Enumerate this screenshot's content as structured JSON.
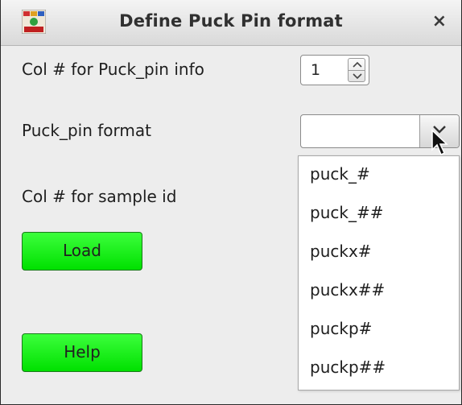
{
  "window": {
    "title": "Define Puck Pin format",
    "close_glyph": "×",
    "icon": "app-logo-icon"
  },
  "form": {
    "col_puck_pin_label": "Col # for Puck_pin info",
    "col_puck_pin_value": "1",
    "puck_pin_format_label": "Puck_pin format",
    "puck_pin_format_value": "",
    "col_sample_id_label": "Col # for sample id"
  },
  "dropdown": {
    "options": [
      "puck_#",
      "puck_##",
      "puckx#",
      "puckx##",
      "puckp#",
      "puckp##"
    ]
  },
  "buttons": {
    "load_label": "Load",
    "help_label": "Help",
    "color": "#00ee00"
  }
}
